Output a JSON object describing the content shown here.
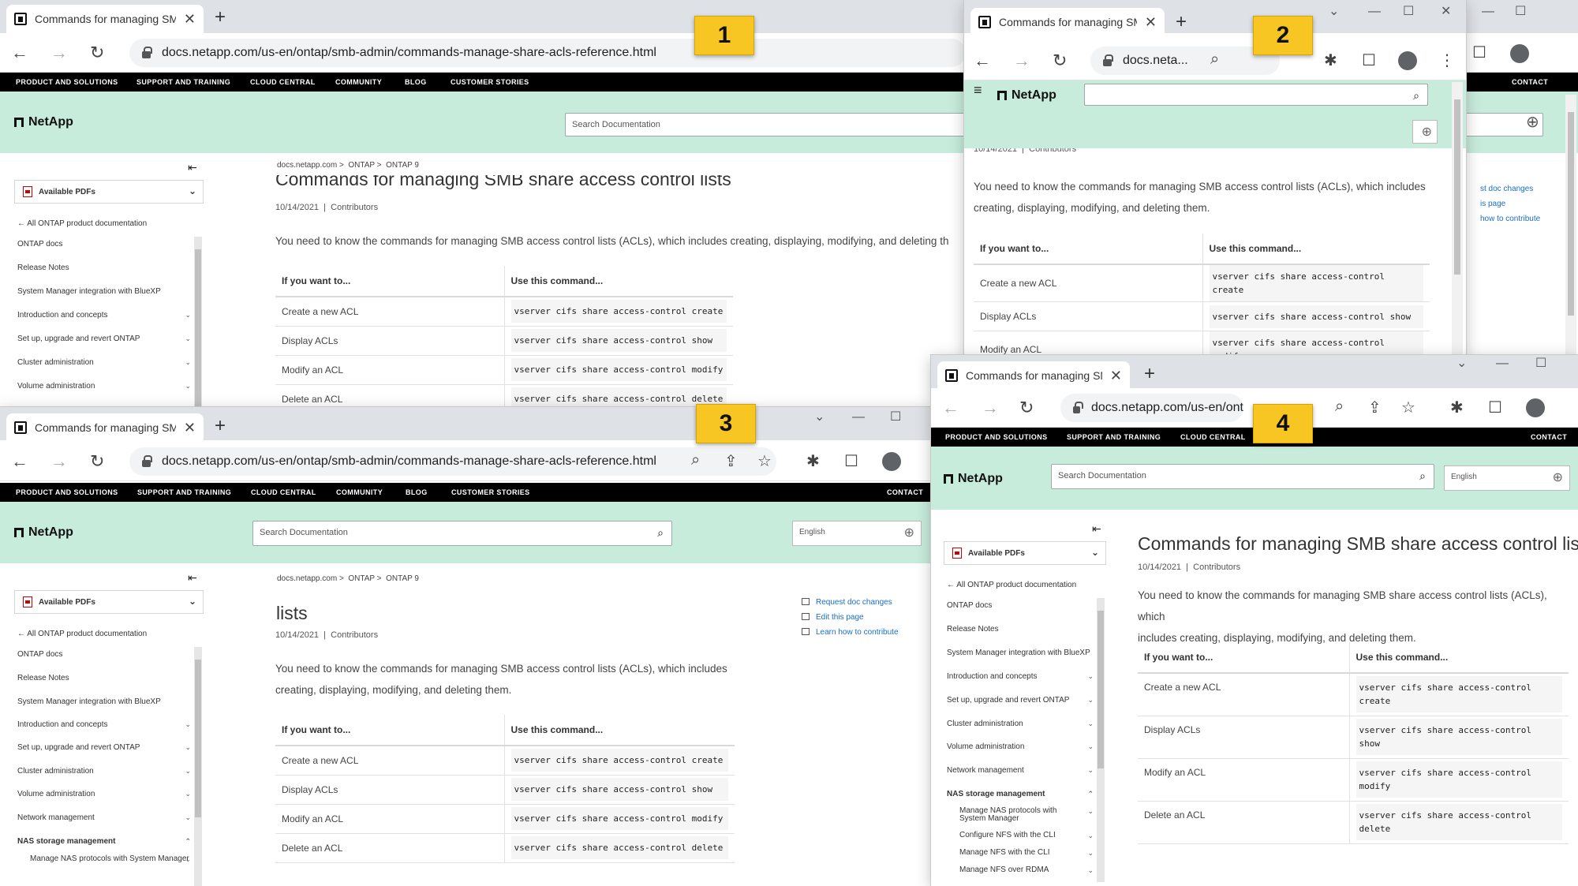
{
  "tab_title": "Commands for managing SMB share access control lists",
  "url_full": "docs.netapp.com/us-en/ontap/smb-admin/commands-manage-share-acls-reference.html",
  "url_w2": "docs.neta...",
  "url_w4": "docs.netapp.com/us-en/ont",
  "nav": {
    "product": "PRODUCT AND SOLUTIONS",
    "support": "SUPPORT AND TRAINING",
    "cloud": "CLOUD CENTRAL",
    "community": "COMMUNITY",
    "blog": "BLOG",
    "stories": "CUSTOMER STORIES",
    "contact": "CONTACT"
  },
  "brand": "NetApp",
  "search_placeholder": "Search Documentation",
  "language": "English",
  "sidebar": {
    "pdfs": "Available PDFs",
    "all_docs": "All ONTAP product documentation",
    "items": [
      "ONTAP docs",
      "Release Notes",
      "System Manager integration with BlueXP",
      "Introduction and concepts",
      "Set up, upgrade and revert ONTAP",
      "Cluster administration",
      "Volume administration",
      "Network management",
      "NAS storage management"
    ],
    "sub_items": [
      "Manage NAS protocols with System Manager",
      "Configure NFS with the CLI",
      "Manage NFS with the CLI",
      "Manage NFS over RDMA"
    ]
  },
  "breadcrumb": {
    "a": "docs.netapp.com",
    "b": "ONTAP",
    "c": "ONTAP 9",
    "sep": ">"
  },
  "page": {
    "title": "Commands for managing SMB share access control lists",
    "title_partial_3": "lists",
    "date": "10/14/2021",
    "contributors": "Contributors",
    "intro": "You need to know the commands for managing SMB access control lists (ACLs), which includes creating, displaying, modifying, and deleting them.",
    "intro_line1_w1": "You need to know the commands for managing SMB access control lists (ACLs), which includes creating, displaying, modifying, and deleting th",
    "intro_w3_l1": "You need to know the commands for managing SMB access control lists (ACLs), which includes",
    "intro_w3_l2": "creating, displaying, modifying, and deleting them.",
    "intro_w2_l1": "You need to know the commands for managing SMB access control lists (ACLs), which includes",
    "intro_w2_l2": "creating, displaying, modifying, and deleting them.",
    "intro_w4_l1": "You need to know the commands for managing SMB share access control lists (ACLs), which",
    "intro_w4_l2": "includes creating, displaying, modifying, and deleting them."
  },
  "table": {
    "col1": "If you want to...",
    "col2": "Use this command...",
    "rows": [
      {
        "action": "Create a new ACL",
        "cmd": "vserver cifs share access-control create",
        "cmd_a": "vserver cifs share access-control",
        "cmd_b": "create"
      },
      {
        "action": "Display ACLs",
        "cmd": "vserver cifs share access-control show",
        "cmd_a": "vserver cifs share access-control",
        "cmd_b": "show"
      },
      {
        "action": "Modify an ACL",
        "cmd": "vserver cifs share access-control modify",
        "cmd_a": "vserver cifs share access-control",
        "cmd_b": "modify"
      },
      {
        "action": "Delete an ACL",
        "cmd": "vserver cifs share access-control delete",
        "cmd_a": "vserver cifs share access-control",
        "cmd_b": "delete"
      }
    ]
  },
  "right_links": {
    "request": "Request doc changes",
    "edit": "Edit this page",
    "learn": "Learn how to contribute",
    "request_clip": "st doc changes",
    "edit_clip": "is page",
    "learn_clip": "how to contribute"
  },
  "labels": {
    "one": "1",
    "two": "2",
    "three": "3",
    "four": "4"
  },
  "glyphs": {
    "back": "←",
    "forward": "→",
    "reload": "↻",
    "newtab": "+",
    "close": "✕",
    "min": "—",
    "max": "☐",
    "search": "⌕",
    "globe": "⊕",
    "chev": "⌄",
    "menu": "≡",
    "collapse": "⇤",
    "star": "☆",
    "share": "⇪",
    "puzzle": "✱",
    "dots": "⋮",
    "chev_up": "⌃"
  },
  "colors": {
    "header_green": "#c8ecdc",
    "badge_yellow": "#f7c623",
    "nav_black": "#000000",
    "link_blue": "#1a6fc4"
  }
}
